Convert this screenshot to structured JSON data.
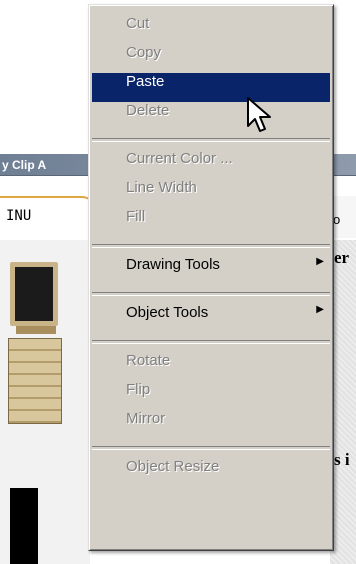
{
  "background": {
    "window_title": "y Clip A",
    "tab_left_label": "INU",
    "tab_right_label": "o",
    "text_fragment_1": "er",
    "text_fragment_2": "s i"
  },
  "context_menu": {
    "groups": [
      {
        "items": [
          {
            "label": "Cut",
            "enabled": false
          },
          {
            "label": "Copy",
            "enabled": false
          },
          {
            "label": "Paste",
            "enabled": true,
            "highlighted": true
          },
          {
            "label": "Delete",
            "enabled": false
          }
        ]
      },
      {
        "items": [
          {
            "label": "Current Color ...",
            "enabled": false
          },
          {
            "label": "Line Width",
            "enabled": false
          },
          {
            "label": "Fill",
            "enabled": false
          }
        ]
      },
      {
        "items": [
          {
            "label": "Drawing Tools",
            "enabled": true,
            "submenu": true
          }
        ]
      },
      {
        "items": [
          {
            "label": "Object Tools",
            "enabled": true,
            "submenu": true
          }
        ]
      },
      {
        "items": [
          {
            "label": "Rotate",
            "enabled": false
          },
          {
            "label": "Flip",
            "enabled": false
          },
          {
            "label": "Mirror",
            "enabled": false
          }
        ]
      },
      {
        "items": [
          {
            "label": "Object Resize",
            "enabled": false
          }
        ]
      }
    ],
    "submenu_arrow": "▶"
  },
  "colors": {
    "menu_bg": "#d4d0c8",
    "highlight": "#0a246a",
    "disabled_text": "#808080"
  },
  "cursor": {
    "icon": "arrow-pointer-icon"
  }
}
